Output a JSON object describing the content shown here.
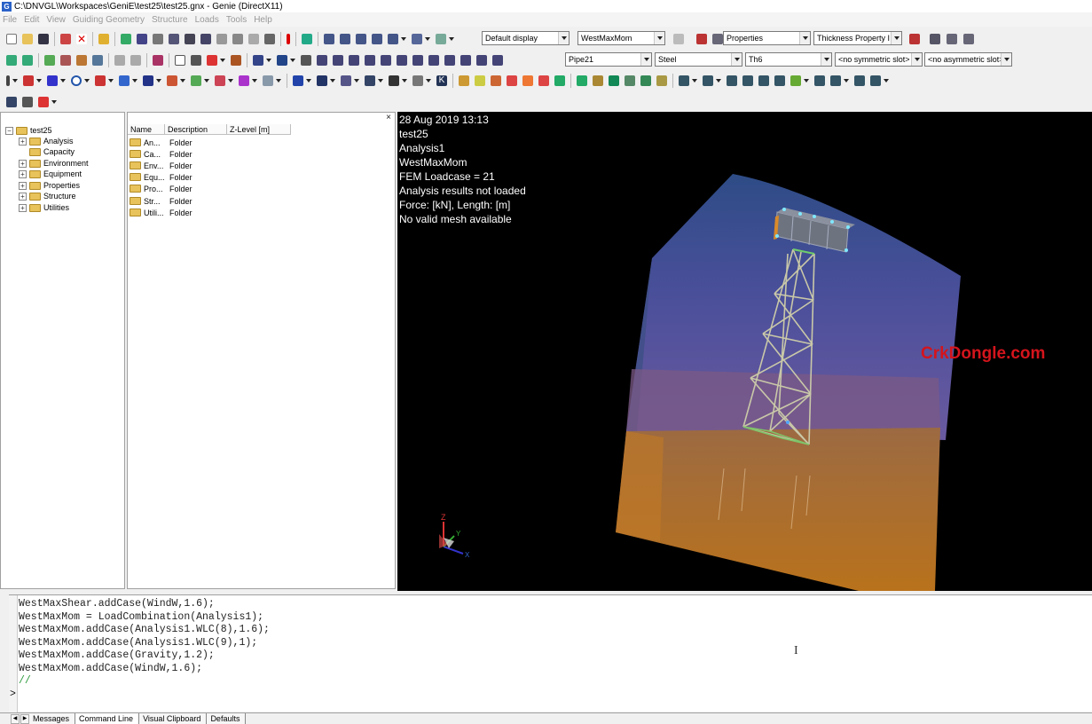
{
  "window": {
    "title": "C:\\DNVGL\\Workspaces\\GeniE\\test25\\test25.gnx - Genie (DirectX11)",
    "icon_letter": "G"
  },
  "menu": [
    "File",
    "Edit",
    "View",
    "Guiding Geometry",
    "Structure",
    "Loads",
    "Tools",
    "Help"
  ],
  "toolbar": {
    "display_combo": "Default display",
    "loadcase_combo": "WestMaxMom",
    "properties_combo": "Properties",
    "thickness_combo": "Thickness Property I",
    "section_combo": "Pipe21",
    "material_combo": "Steel",
    "thickness_value_combo": "Th6",
    "symmetric_combo": "<no symmetric slot>",
    "asymmetric_combo": "<no asymmetric slot>"
  },
  "tree": {
    "root": "test25",
    "items": [
      "Analysis",
      "Capacity",
      "Environment",
      "Equipment",
      "Properties",
      "Structure",
      "Utilities"
    ],
    "expandable": [
      true,
      false,
      true,
      true,
      true,
      true,
      true
    ]
  },
  "list": {
    "columns": [
      "Name",
      "Description",
      "Z-Level [m]"
    ],
    "rows": [
      {
        "name": "An...",
        "description": "Folder"
      },
      {
        "name": "Ca...",
        "description": "Folder"
      },
      {
        "name": "Env...",
        "description": "Folder"
      },
      {
        "name": "Equ...",
        "description": "Folder"
      },
      {
        "name": "Pro...",
        "description": "Folder"
      },
      {
        "name": "Str...",
        "description": "Folder"
      },
      {
        "name": "Utili...",
        "description": "Folder"
      }
    ],
    "close_glyph": "×"
  },
  "viewport": {
    "info_lines": [
      "28 Aug 2019 13:13",
      "test25",
      "Analysis1",
      "WestMaxMom",
      "FEM Loadcase = 21",
      "Analysis results not loaded",
      "Force: [kN], Length: [m]",
      "No valid mesh available"
    ],
    "watermark": "CrkDongle.com",
    "axis_labels": {
      "z": "Z",
      "x": "X",
      "y": "Y"
    },
    "colors": {
      "water": "#3a5aa8",
      "seabed": "#c4781e",
      "tower": "#c8c8b0",
      "topside": "#7a7f8a"
    }
  },
  "console": {
    "lines": [
      "WestMaxShear.addCase(WindW,1.6);",
      "WestMaxMom = LoadCombination(Analysis1);",
      "WestMaxMom.addCase(Analysis1.WLC(8),1.6);",
      "WestMaxMom.addCase(Analysis1.WLC(9),1);",
      "WestMaxMom.addCase(Gravity,1.2);",
      "WestMaxMom.addCase(WindW,1.6);",
      "//"
    ],
    "prompt": ">"
  },
  "tabs": [
    "Messages",
    "Command Line",
    "Visual Clipboard",
    "Defaults"
  ],
  "active_tab": "Command Line"
}
